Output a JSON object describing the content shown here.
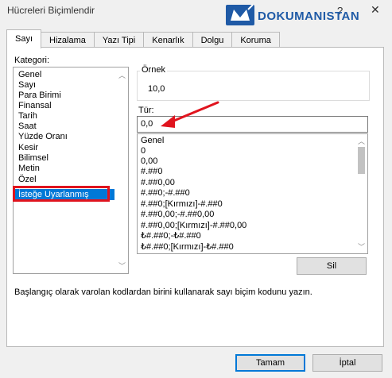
{
  "window": {
    "title": "Hücreleri Biçimlendir",
    "help": "?",
    "close": "✕"
  },
  "watermark": {
    "text": "DOKUMANISTAN"
  },
  "tabs": [
    "Sayı",
    "Hizalama",
    "Yazı Tipi",
    "Kenarlık",
    "Dolgu",
    "Koruma"
  ],
  "category": {
    "label": "Kategori:",
    "items": [
      "Genel",
      "Sayı",
      "Para Birimi",
      "Finansal",
      "Tarih",
      "Saat",
      "Yüzde Oranı",
      "Kesir",
      "Bilimsel",
      "Metin",
      "Özel",
      "İsteğe Uyarlanmış"
    ],
    "selected": "İsteğe Uyarlanmış"
  },
  "sample": {
    "label": "Örnek",
    "value": "10,0"
  },
  "type": {
    "label": "Tür:",
    "value": "0,0"
  },
  "formats": [
    "Genel",
    "0",
    "0,00",
    "#.##0",
    "#.##0,00",
    "#.##0;-#.##0",
    "#.##0;[Kırmızı]-#.##0",
    "#.##0,00;-#.##0,00",
    "#.##0,00;[Kırmızı]-#.##0,00",
    "₺#.##0;-₺#.##0",
    "₺#.##0;[Kırmızı]-₺#.##0"
  ],
  "buttons": {
    "delete": "Sil",
    "ok": "Tamam",
    "cancel": "İptal"
  },
  "description": "Başlangıç olarak varolan kodlardan birini kullanarak sayı biçim kodunu yazın.",
  "colors": {
    "selection": "#0078d7",
    "highlight": "#e0141e",
    "brand": "#1f5aa6"
  }
}
